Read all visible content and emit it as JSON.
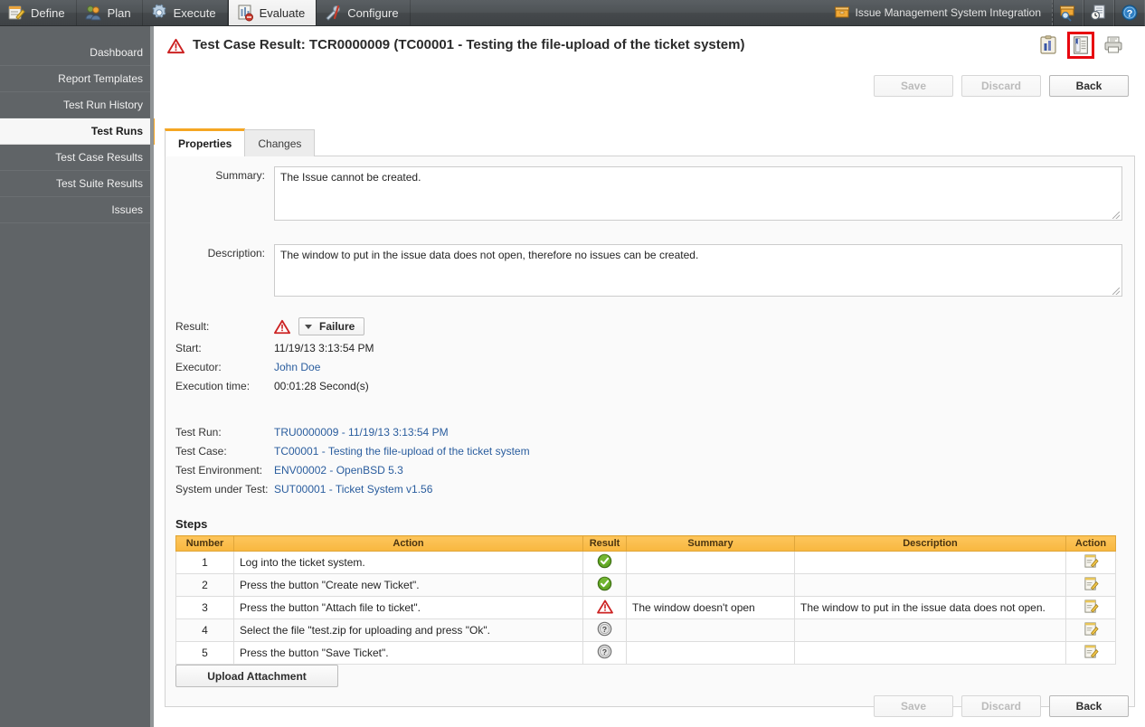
{
  "topnav": {
    "items": [
      {
        "label": "Define",
        "icon": "notepad-pencil-icon",
        "active": false
      },
      {
        "label": "Plan",
        "icon": "users-icon",
        "active": false
      },
      {
        "label": "Execute",
        "icon": "gear-icon",
        "active": false
      },
      {
        "label": "Evaluate",
        "icon": "report-chart-icon",
        "active": true
      },
      {
        "label": "Configure",
        "icon": "tools-icon",
        "active": false
      }
    ],
    "integration_label": "Issue Management System Integration",
    "integration_icon": "archive-box-icon",
    "right_icons": [
      {
        "name": "search-archive-icon"
      },
      {
        "name": "history-document-icon"
      },
      {
        "name": "help-icon"
      }
    ]
  },
  "sidebar": {
    "items": [
      {
        "label": "Dashboard",
        "selected": false
      },
      {
        "label": "Report Templates",
        "selected": false
      },
      {
        "label": "Test Run History",
        "selected": false
      },
      {
        "label": "Test Runs",
        "selected": true
      },
      {
        "label": "Test Case Results",
        "selected": false
      },
      {
        "label": "Test Suite Results",
        "selected": false
      },
      {
        "label": "Issues",
        "selected": false
      }
    ]
  },
  "page": {
    "title": "Test Case Result: TCR0000009 (TC00001 - Testing the file-upload of the ticket system)",
    "title_icon": "warning-triangle-icon",
    "title_icons": [
      {
        "name": "reports-clipboard-icon",
        "highlighted": false
      },
      {
        "name": "document-report-icon",
        "highlighted": true
      },
      {
        "name": "print-icon",
        "highlighted": false
      }
    ]
  },
  "toolbar": {
    "save_label": "Save",
    "discard_label": "Discard",
    "back_label": "Back"
  },
  "tabs": [
    {
      "label": "Properties",
      "active": true
    },
    {
      "label": "Changes",
      "active": false
    }
  ],
  "form": {
    "summary_label": "Summary:",
    "summary_value": "The Issue cannot be created.",
    "description_label": "Description:",
    "description_value": "The window to put in the issue data does not open, therefore no issues can be created.",
    "result_label": "Result:",
    "result_value": "Failure",
    "result_icon": "warning-triangle-icon",
    "start_label": "Start:",
    "start_value": "11/19/13 3:13:54 PM",
    "executor_label": "Executor:",
    "executor_value": "John Doe",
    "execution_time_label": "Execution time:",
    "execution_time_value": "00:01:28 Second(s)",
    "test_run_label": "Test Run:",
    "test_run_value": "TRU0000009 - 11/19/13 3:13:54 PM",
    "test_case_label": "Test Case:",
    "test_case_value": "TC00001 - Testing the file-upload of the ticket system",
    "test_env_label": "Test Environment:",
    "test_env_value": "ENV00002 - OpenBSD 5.3",
    "sut_label": "System under Test:",
    "sut_value": "SUT00001 - Ticket System v1.56"
  },
  "steps": {
    "title": "Steps",
    "columns": [
      "Number",
      "Action",
      "Result",
      "Summary",
      "Description",
      "Action"
    ],
    "rows": [
      {
        "number": "1",
        "action": "Log into the ticket system.",
        "result_icon": "success-check-icon",
        "summary": "",
        "description": "",
        "row_action_icon": "edit-pencil-icon"
      },
      {
        "number": "2",
        "action": "Press the button \"Create new Ticket\".",
        "result_icon": "success-check-icon",
        "summary": "",
        "description": "",
        "row_action_icon": "edit-pencil-icon"
      },
      {
        "number": "3",
        "action": "Press the button \"Attach file to ticket\".",
        "result_icon": "warning-triangle-icon",
        "summary": "The window doesn't open",
        "description": "The window to put in the issue data does not open.",
        "row_action_icon": "edit-pencil-icon"
      },
      {
        "number": "4",
        "action": "Select the file \"test.zip for uploading and press \"Ok\".",
        "result_icon": "unknown-question-icon",
        "summary": "",
        "description": "",
        "row_action_icon": "edit-pencil-icon"
      },
      {
        "number": "5",
        "action": "Press the button \"Save Ticket\".",
        "result_icon": "unknown-question-icon",
        "summary": "",
        "description": "",
        "row_action_icon": "edit-pencil-icon"
      }
    ]
  },
  "actions": {
    "upload_attachment_label": "Upload Attachment"
  },
  "colors": {
    "accent_orange": "#f5a623",
    "table_header": "#f8b73f",
    "link_blue": "#2a5d9e",
    "error_red": "#cc2222",
    "success_green": "#5aa01e",
    "sidebar_bg": "#606467",
    "topbar_bg": "#4e5356",
    "highlight_box": "#e8070f"
  }
}
